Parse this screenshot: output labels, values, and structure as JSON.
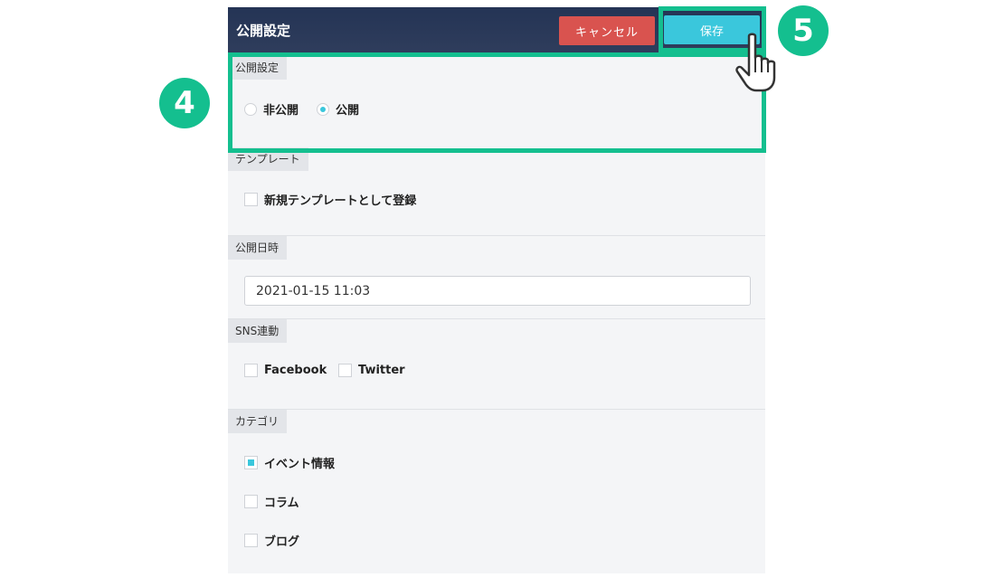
{
  "header": {
    "title": "公開設定",
    "cancel_label": "キャンセル",
    "save_label": "保存"
  },
  "visibility": {
    "label": "公開設定",
    "options": [
      {
        "label": "非公開",
        "selected": false
      },
      {
        "label": "公開",
        "selected": true
      }
    ]
  },
  "template": {
    "label": "テンプレート",
    "register_label": "新規テンプレートとして登録",
    "checked": false
  },
  "publish_date": {
    "label": "公開日時",
    "value": "2021-01-15 11:03"
  },
  "sns": {
    "label": "SNS連動",
    "options": [
      {
        "label": "Facebook",
        "checked": false
      },
      {
        "label": "Twitter",
        "checked": false
      }
    ]
  },
  "category": {
    "label": "カテゴリ",
    "options": [
      {
        "label": "イベント情報",
        "checked": true
      },
      {
        "label": "コラム",
        "checked": false
      },
      {
        "label": "ブログ",
        "checked": false
      }
    ]
  },
  "annotations": {
    "step4": "4",
    "step5": "5"
  },
  "colors": {
    "accent": "#3ac7dc",
    "cancel": "#d9534f",
    "header": "#243455",
    "highlight": "#14bf8f"
  },
  "icons": {
    "cursor": "hand-pointer-icon"
  }
}
